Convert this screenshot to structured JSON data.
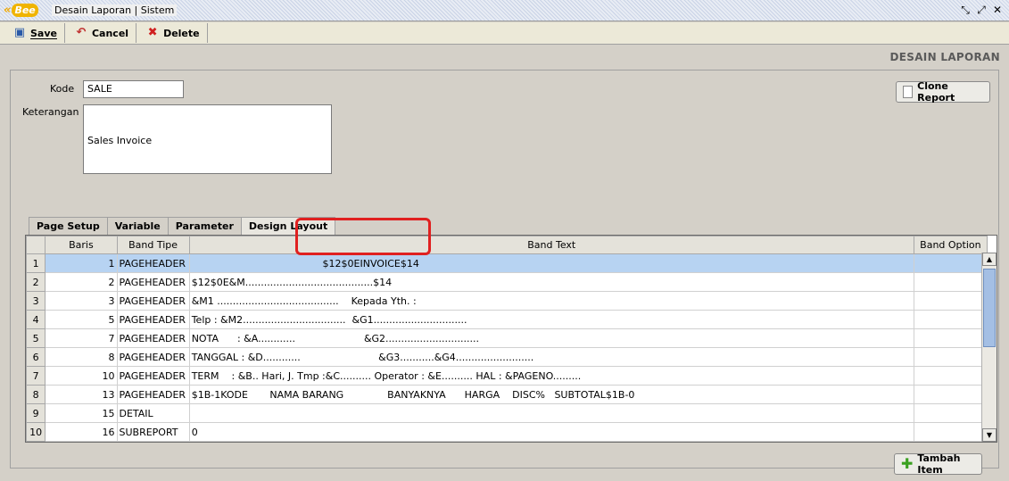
{
  "window": {
    "title": "Desain Laporan | Sistem",
    "logo_prefix": "«",
    "logo_text": "Bee"
  },
  "toolbar": {
    "save_label": "Save",
    "cancel_label": "Cancel",
    "delete_label": "Delete"
  },
  "heading": "DESAIN LAPORAN",
  "form": {
    "kode_label": "Kode",
    "kode_value": "SALE",
    "keterangan_label": "Keterangan",
    "keterangan_value": "Sales Invoice",
    "clone_label": "Clone Report"
  },
  "tabs": [
    "Page Setup",
    "Variable",
    "Parameter",
    "Design Layout"
  ],
  "grid": {
    "columns": [
      "Baris",
      "Band Tipe",
      "Band Text",
      "Band Option"
    ],
    "rows": [
      {
        "n": "1",
        "baris": "1",
        "tipe": "PAGEHEADER",
        "text": "                                          $12$0EINVOICE$14",
        "option": ""
      },
      {
        "n": "2",
        "baris": "2",
        "tipe": "PAGEHEADER",
        "text": "$12$0E&M.........................................$14",
        "option": ""
      },
      {
        "n": "3",
        "baris": "3",
        "tipe": "PAGEHEADER",
        "text": "&M1 .......................................    Kepada Yth. :",
        "option": ""
      },
      {
        "n": "4",
        "baris": "5",
        "tipe": "PAGEHEADER",
        "text": "Telp : &M2.................................  &G1..............................",
        "option": ""
      },
      {
        "n": "5",
        "baris": "7",
        "tipe": "PAGEHEADER",
        "text": "NOTA      : &A............                      &G2..............................",
        "option": ""
      },
      {
        "n": "6",
        "baris": "8",
        "tipe": "PAGEHEADER",
        "text": "TANGGAL : &D............                         &G3...........&G4.........................",
        "option": ""
      },
      {
        "n": "7",
        "baris": "10",
        "tipe": "PAGEHEADER",
        "text": "TERM    : &B.. Hari, J. Tmp :&C.......... Operator : &E.......... HAL : &PAGENO.........",
        "option": ""
      },
      {
        "n": "8",
        "baris": "13",
        "tipe": "PAGEHEADER",
        "text": "$1B-1KODE       NAMA BARANG              BANYAKNYA      HARGA    DISC%   SUBTOTAL$1B-0",
        "option": ""
      },
      {
        "n": "9",
        "baris": "15",
        "tipe": "DETAIL",
        "text": "",
        "option": ""
      },
      {
        "n": "10",
        "baris": "16",
        "tipe": "SUBREPORT",
        "text": "0",
        "option": ""
      }
    ]
  },
  "add_item_label": "Tambah Item",
  "colors": {
    "accent": "#b7d3f2",
    "highlight": "#e02020",
    "logo": "#f0b400"
  }
}
